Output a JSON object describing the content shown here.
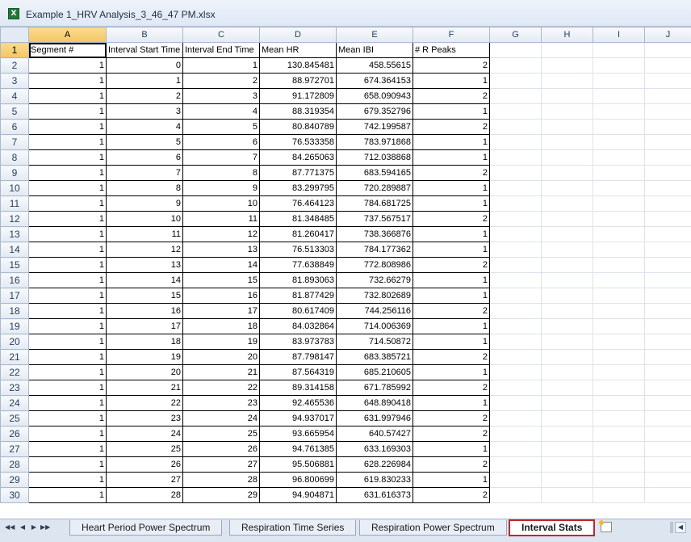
{
  "window": {
    "title": "Example 1_HRV Analysis_3_46_47 PM.xlsx"
  },
  "columns": [
    "A",
    "B",
    "C",
    "D",
    "E",
    "F",
    "G",
    "H",
    "I",
    "J"
  ],
  "selected_column": "A",
  "selected_row": 1,
  "headers": [
    "Segment #",
    "Interval Start Time",
    "Interval End Time",
    "Mean HR",
    "Mean IBI",
    "# R Peaks"
  ],
  "rows": [
    [
      "1",
      "0",
      "1",
      "130.845481",
      "458.55615",
      "2"
    ],
    [
      "1",
      "1",
      "2",
      "88.972701",
      "674.364153",
      "1"
    ],
    [
      "1",
      "2",
      "3",
      "91.172809",
      "658.090943",
      "2"
    ],
    [
      "1",
      "3",
      "4",
      "88.319354",
      "679.352796",
      "1"
    ],
    [
      "1",
      "4",
      "5",
      "80.840789",
      "742.199587",
      "2"
    ],
    [
      "1",
      "5",
      "6",
      "76.533358",
      "783.971868",
      "1"
    ],
    [
      "1",
      "6",
      "7",
      "84.265063",
      "712.038868",
      "1"
    ],
    [
      "1",
      "7",
      "8",
      "87.771375",
      "683.594165",
      "2"
    ],
    [
      "1",
      "8",
      "9",
      "83.299795",
      "720.289887",
      "1"
    ],
    [
      "1",
      "9",
      "10",
      "76.464123",
      "784.681725",
      "1"
    ],
    [
      "1",
      "10",
      "11",
      "81.348485",
      "737.567517",
      "2"
    ],
    [
      "1",
      "11",
      "12",
      "81.260417",
      "738.366876",
      "1"
    ],
    [
      "1",
      "12",
      "13",
      "76.513303",
      "784.177362",
      "1"
    ],
    [
      "1",
      "13",
      "14",
      "77.638849",
      "772.808986",
      "2"
    ],
    [
      "1",
      "14",
      "15",
      "81.893063",
      "732.66279",
      "1"
    ],
    [
      "1",
      "15",
      "16",
      "81.877429",
      "732.802689",
      "1"
    ],
    [
      "1",
      "16",
      "17",
      "80.617409",
      "744.256116",
      "2"
    ],
    [
      "1",
      "17",
      "18",
      "84.032864",
      "714.006369",
      "1"
    ],
    [
      "1",
      "18",
      "19",
      "83.973783",
      "714.50872",
      "1"
    ],
    [
      "1",
      "19",
      "20",
      "87.798147",
      "683.385721",
      "2"
    ],
    [
      "1",
      "20",
      "21",
      "87.564319",
      "685.210605",
      "1"
    ],
    [
      "1",
      "21",
      "22",
      "89.314158",
      "671.785992",
      "2"
    ],
    [
      "1",
      "22",
      "23",
      "92.465536",
      "648.890418",
      "1"
    ],
    [
      "1",
      "23",
      "24",
      "94.937017",
      "631.997946",
      "2"
    ],
    [
      "1",
      "24",
      "25",
      "93.665954",
      "640.57427",
      "2"
    ],
    [
      "1",
      "25",
      "26",
      "94.761385",
      "633.169303",
      "1"
    ],
    [
      "1",
      "26",
      "27",
      "95.506881",
      "628.226984",
      "2"
    ],
    [
      "1",
      "27",
      "28",
      "96.800699",
      "619.830233",
      "1"
    ],
    [
      "1",
      "28",
      "29",
      "94.904871",
      "631.616373",
      "2"
    ]
  ],
  "sheet_tabs": [
    "Heart Period Power Spectrum",
    "Respiration Time Series",
    "Respiration Power Spectrum",
    "Interval Stats"
  ],
  "active_sheet": "Interval Stats",
  "colors": {
    "header_selected": "#f5c563",
    "active_tab_border": "#c0272d",
    "excel_green": "#1f7a3a"
  }
}
